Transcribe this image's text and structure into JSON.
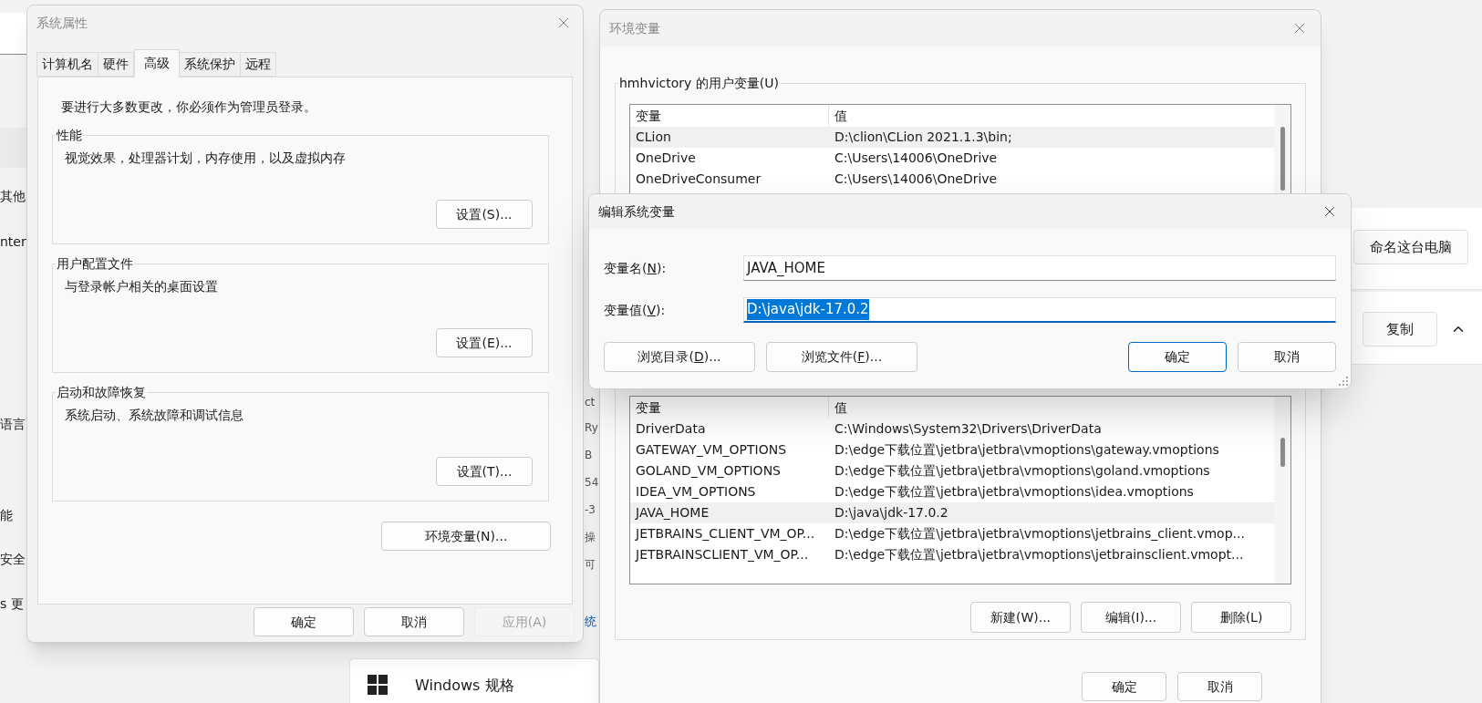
{
  "desktop": {
    "left_fragments": [
      "其他",
      "nter",
      "语言",
      "能",
      "安全",
      "s 更"
    ],
    "middle_fragments": [
      "ct",
      "Ry",
      "B",
      "54",
      "-3",
      "操",
      "可"
    ],
    "link_fragment": "统",
    "rename_button": "命名这台电脑",
    "copy_button": "复制",
    "spec_card_title": "Windows 规格"
  },
  "system_properties": {
    "title": "系统属性",
    "tabs": [
      {
        "label": "计算机名",
        "selected": false
      },
      {
        "label": "硬件",
        "selected": false
      },
      {
        "label": "高级",
        "selected": true
      },
      {
        "label": "系统保护",
        "selected": false
      },
      {
        "label": "远程",
        "selected": false
      }
    ],
    "admin_note": "要进行大多数更改，你必须作为管理员登录。",
    "groups": [
      {
        "title": "性能",
        "description": "视觉效果，处理器计划，内存使用，以及虚拟内存",
        "button": "设置(S)..."
      },
      {
        "title": "用户配置文件",
        "description": "与登录帐户相关的桌面设置",
        "button": "设置(E)..."
      },
      {
        "title": "启动和故障恢复",
        "description": "系统启动、系统故障和调试信息",
        "button": "设置(T)..."
      }
    ],
    "env_button": "环境变量(N)...",
    "buttons": [
      {
        "label": "确定",
        "disabled": false
      },
      {
        "label": "取消",
        "disabled": false
      },
      {
        "label": "应用(A)",
        "disabled": true
      }
    ]
  },
  "environment_variables": {
    "title": "环境变量",
    "user_section": {
      "title": "hmhvictory 的用户变量(U)",
      "columns": [
        "变量",
        "值"
      ],
      "rows": [
        {
          "name": "CLion",
          "value": "D:\\clion\\CLion 2021.1.3\\bin;",
          "selected": true
        },
        {
          "name": "OneDrive",
          "value": "C:\\Users\\14006\\OneDrive",
          "selected": false
        },
        {
          "name": "OneDriveConsumer",
          "value": "C:\\Users\\14006\\OneDrive",
          "selected": false
        }
      ]
    },
    "system_section": {
      "columns": [
        "变量",
        "值"
      ],
      "rows": [
        {
          "name": "DriverData",
          "value": "C:\\Windows\\System32\\Drivers\\DriverData",
          "selected": false
        },
        {
          "name": "GATEWAY_VM_OPTIONS",
          "value": "D:\\edge下载位置\\jetbra\\jetbra\\vmoptions\\gateway.vmoptions",
          "selected": false
        },
        {
          "name": "GOLAND_VM_OPTIONS",
          "value": "D:\\edge下载位置\\jetbra\\jetbra\\vmoptions\\goland.vmoptions",
          "selected": false
        },
        {
          "name": "IDEA_VM_OPTIONS",
          "value": "D:\\edge下载位置\\jetbra\\jetbra\\vmoptions\\idea.vmoptions",
          "selected": false
        },
        {
          "name": "JAVA_HOME",
          "value": "D:\\java\\jdk-17.0.2",
          "selected": true
        },
        {
          "name": "JETBRAINS_CLIENT_VM_OP...",
          "value": "D:\\edge下载位置\\jetbra\\jetbra\\vmoptions\\jetbrains_client.vmop...",
          "selected": false
        },
        {
          "name": "JETBRAINSCLIENT_VM_OP...",
          "value": "D:\\edge下载位置\\jetbra\\jetbra\\vmoptions\\jetbrainsclient.vmopt...",
          "selected": false
        }
      ],
      "buttons": [
        "新建(W)...",
        "编辑(I)...",
        "删除(L)"
      ]
    },
    "buttons": [
      "确定",
      "取消"
    ]
  },
  "edit_dialog": {
    "title": "编辑系统变量",
    "fields": [
      {
        "label": [
          "变量名(",
          "N",
          "):"
        ],
        "value": "JAVA_HOME",
        "focused": false,
        "value_selected": false
      },
      {
        "label": [
          "变量值(",
          "V",
          "):"
        ],
        "value": "D:\\java\\jdk-17.0.2",
        "focused": true,
        "value_selected": true
      }
    ],
    "buttons": [
      {
        "parts": [
          "浏览目录(",
          "D",
          ")..."
        ],
        "default": false
      },
      {
        "parts": [
          "浏览文件(",
          "F",
          ")..."
        ],
        "default": false
      },
      {
        "parts": [
          "确定"
        ],
        "default": true
      },
      {
        "parts": [
          "取消"
        ],
        "default": false
      }
    ]
  }
}
